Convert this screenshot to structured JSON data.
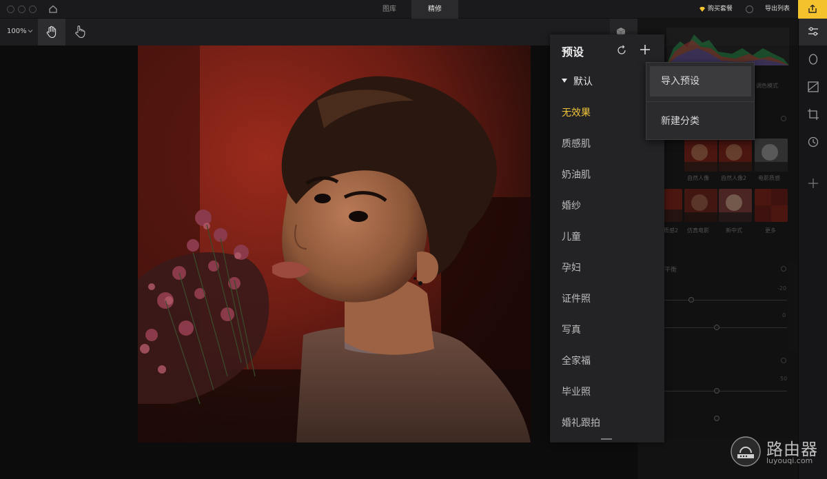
{
  "titlebar": {
    "tabs": [
      {
        "label": "图库",
        "active": false
      },
      {
        "label": "精修",
        "active": true
      }
    ],
    "buy_label": "购买套餐",
    "export_list_label": "导出列表"
  },
  "toolbar": {
    "zoom_label": "100%"
  },
  "preset_panel": {
    "title": "预设",
    "category": "默认",
    "items": [
      "无效果",
      "质感肌",
      "奶油肌",
      "婚纱",
      "儿童",
      "孕妇",
      "证件照",
      "写真",
      "全家福",
      "毕业照",
      "婚礼跟拍"
    ],
    "selected_index": 0
  },
  "dropdown": {
    "items": [
      "导入预设",
      "新建分类"
    ]
  },
  "right_panel": {
    "mode_label": "调色模式",
    "thumb_row1": [
      "自然人像",
      "自然人像2",
      "电影质感"
    ],
    "thumb_row2": [
      "质感2",
      "仿真电影",
      "新中式",
      "更多"
    ],
    "section_label": "平衡",
    "values": [
      "-20",
      "0",
      "50"
    ]
  },
  "watermark": {
    "title": "路由器",
    "url": "luyouqi.com"
  },
  "colors": {
    "accent": "#f3c22d",
    "selected_text": "#f0c43a"
  }
}
